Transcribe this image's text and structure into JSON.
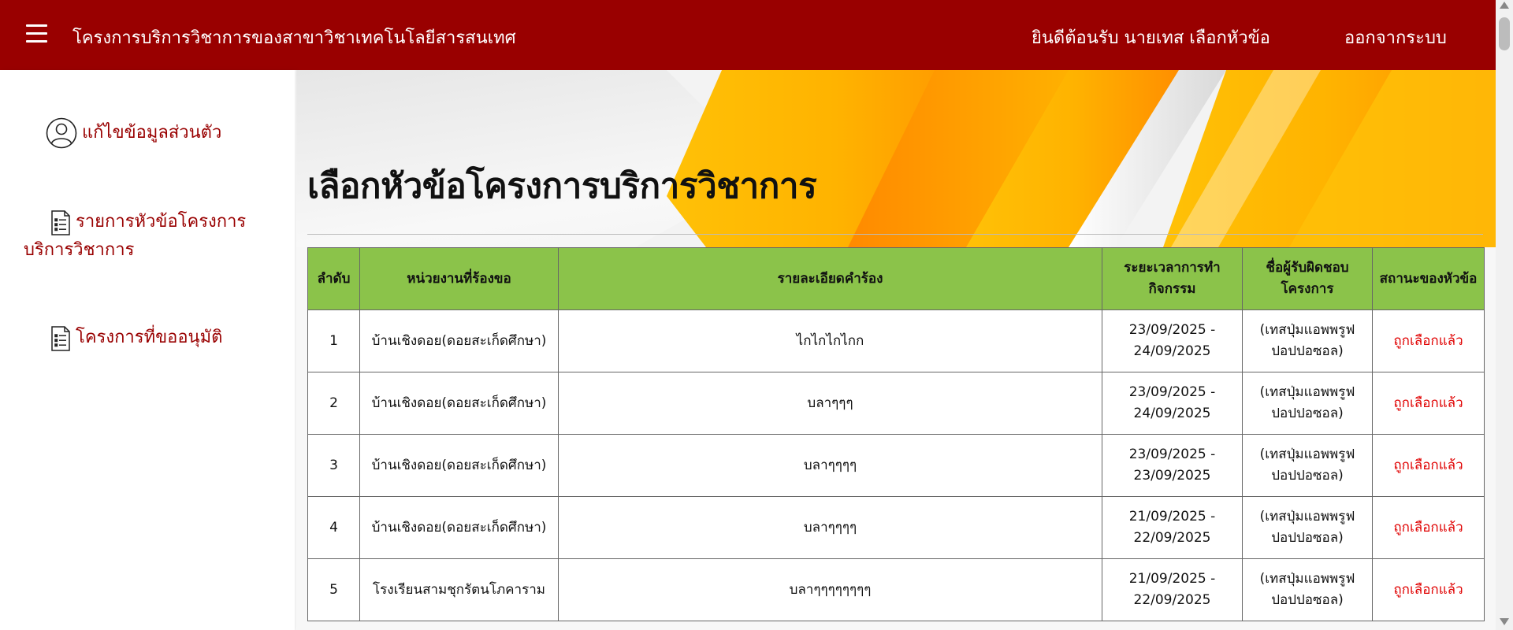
{
  "header": {
    "brand": "โครงการบริการวิชาการของสาขาวิชาเทคโนโลยีสารสนเทศ",
    "welcome": "ยินดีต้อนรับ นายเทส เลือกหัวข้อ",
    "logout": "ออกจากระบบ"
  },
  "sidebar": {
    "items": [
      {
        "label": "แก้ไขข้อมูลส่วนตัว",
        "icon": "user-circle-icon"
      },
      {
        "label": "รายการหัวข้อโครงการบริการวิชาการ",
        "icon": "document-list-icon"
      },
      {
        "label": "โครงการที่ขออนุมัติ",
        "icon": "document-list-icon"
      }
    ]
  },
  "main": {
    "title": "เลือกหัวข้อโครงการบริการวิชาการ"
  },
  "table": {
    "headers": [
      "ลำดับ",
      "หน่วยงานที่ร้องขอ",
      "รายละเอียดคำร้อง",
      "ระยะเวลาการทำกิจกรรม",
      "ชื่อผู้รับผิดชอบโครงการ",
      "สถานะของหัวข้อ"
    ],
    "rows": [
      {
        "no": "1",
        "agency": "บ้านเชิงดอย(ดอยสะเก็ดศึกษา)",
        "detail": "ไกไกไกไกก",
        "period": "23/09/2025 - 24/09/2025",
        "owner": "(เทสปุ่มแอพพรูฟ ปอปปอซอล)",
        "status": "ถูกเลือกแล้ว"
      },
      {
        "no": "2",
        "agency": "บ้านเชิงดอย(ดอยสะเก็ดศึกษา)",
        "detail": "บลาๆๆๆ",
        "period": "23/09/2025 - 24/09/2025",
        "owner": "(เทสปุ่มแอพพรูฟ ปอปปอซอล)",
        "status": "ถูกเลือกแล้ว"
      },
      {
        "no": "3",
        "agency": "บ้านเชิงดอย(ดอยสะเก็ดศึกษา)",
        "detail": "บลาๆๆๆๆ",
        "period": "23/09/2025 - 23/09/2025",
        "owner": "(เทสปุ่มแอพพรูฟ ปอปปอซอล)",
        "status": "ถูกเลือกแล้ว"
      },
      {
        "no": "4",
        "agency": "บ้านเชิงดอย(ดอยสะเก็ดศึกษา)",
        "detail": "บลาๆๆๆๆ",
        "period": "21/09/2025 - 22/09/2025",
        "owner": "(เทสปุ่มแอพพรูฟ ปอปปอซอล)",
        "status": "ถูกเลือกแล้ว"
      },
      {
        "no": "5",
        "agency": "โรงเรียนสามชุกรัตนโภคาราม",
        "detail": "บลาๆๆๆๆๆๆๆๆ",
        "period": "21/09/2025 - 22/09/2025",
        "owner": "(เทสปุ่มแอพพรูฟ ปอปปอซอล)",
        "status": "ถูกเลือกแล้ว"
      }
    ]
  },
  "colors": {
    "header_bg": "#990000",
    "sidebar_text": "#990000",
    "table_header_bg": "#8bc34a",
    "status_text": "#e00000",
    "banner_accent": "#ffb300"
  }
}
